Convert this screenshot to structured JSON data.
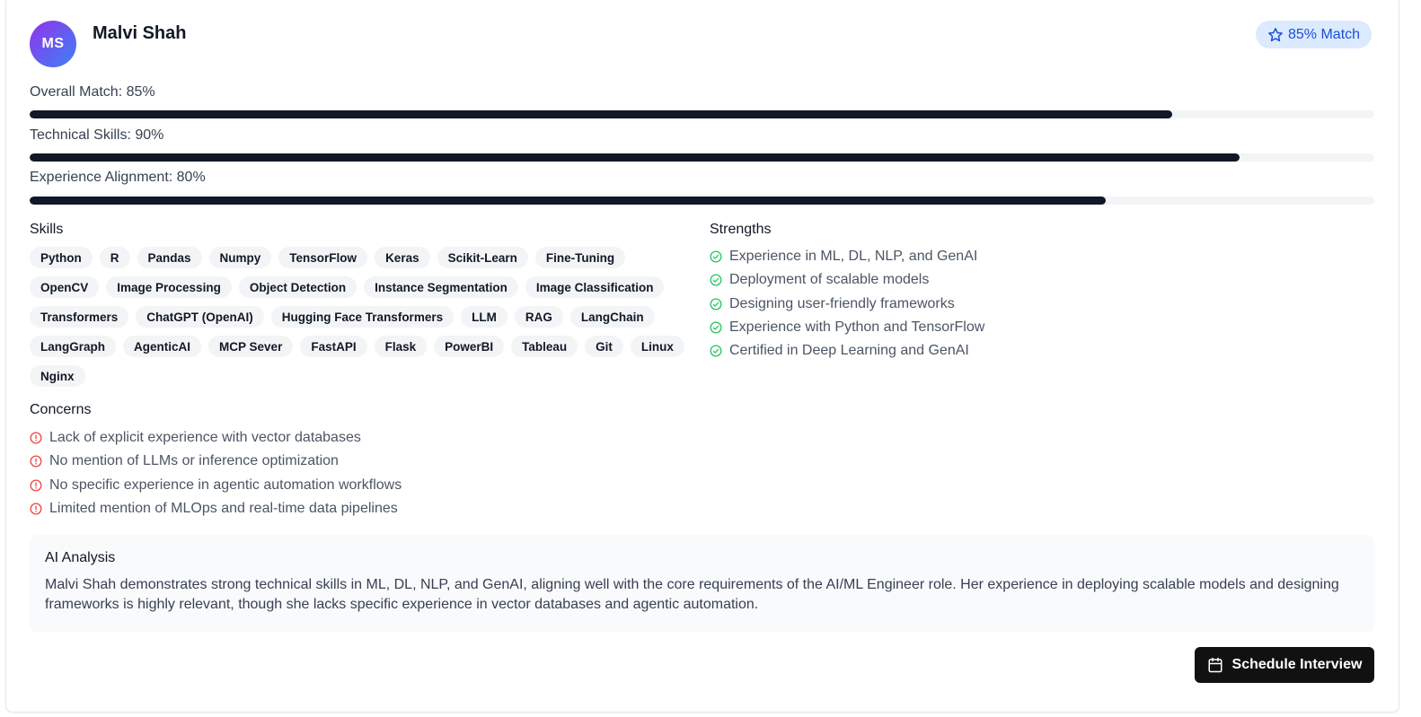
{
  "candidate": {
    "initials": "MS",
    "name": "Malvi Shah",
    "match_badge": "85% Match"
  },
  "metrics": [
    {
      "label": "Overall Match: 85%",
      "value": 0.85
    },
    {
      "label": "Technical Skills: 90%",
      "value": 0.9
    },
    {
      "label": "Experience Alignment: 80%",
      "value": 0.8
    }
  ],
  "skills": {
    "title": "Skills",
    "items": [
      "Python",
      "R",
      "Pandas",
      "Numpy",
      "TensorFlow",
      "Keras",
      "Scikit-Learn",
      "Fine-Tuning",
      "OpenCV",
      "Image Processing",
      "Object Detection",
      "Instance Segmentation",
      "Image Classification",
      "Transformers",
      "ChatGPT (OpenAI)",
      "Hugging Face Transformers",
      "LLM",
      "RAG",
      "LangChain",
      "LangGraph",
      "AgenticAI",
      "MCP Sever",
      "FastAPI",
      "Flask",
      "PowerBI",
      "Tableau",
      "Git",
      "Linux",
      "Nginx"
    ]
  },
  "strengths": {
    "title": "Strengths",
    "items": [
      "Experience in ML, DL, NLP, and GenAI",
      "Deployment of scalable models",
      "Designing user-friendly frameworks",
      "Experience with Python and TensorFlow",
      "Certified in Deep Learning and GenAI"
    ]
  },
  "concerns": {
    "title": "Concerns",
    "items": [
      "Lack of explicit experience with vector databases",
      "No mention of LLMs or inference optimization",
      "No specific experience in agentic automation workflows",
      "Limited mention of MLOps and real-time data pipelines"
    ]
  },
  "analysis": {
    "title": "AI Analysis",
    "text": "Malvi Shah demonstrates strong technical skills in ML, DL, NLP, and GenAI, aligning well with the core requirements of the AI/ML Engineer role. Her experience in deploying scalable models and designing frameworks is highly relevant, though she lacks specific experience in vector databases and agentic automation."
  },
  "actions": {
    "schedule_label": "Schedule Interview"
  },
  "colors": {
    "accent": "#1d4ed8",
    "badge_bg": "#dbeafe",
    "bar_fill": "#111827",
    "strength_icon": "#22c55e",
    "concern_icon": "#ef4444"
  },
  "icons": {
    "badge": "star-icon",
    "strength": "check-circle-icon",
    "concern": "alert-circle-icon",
    "schedule": "calendar-icon"
  }
}
